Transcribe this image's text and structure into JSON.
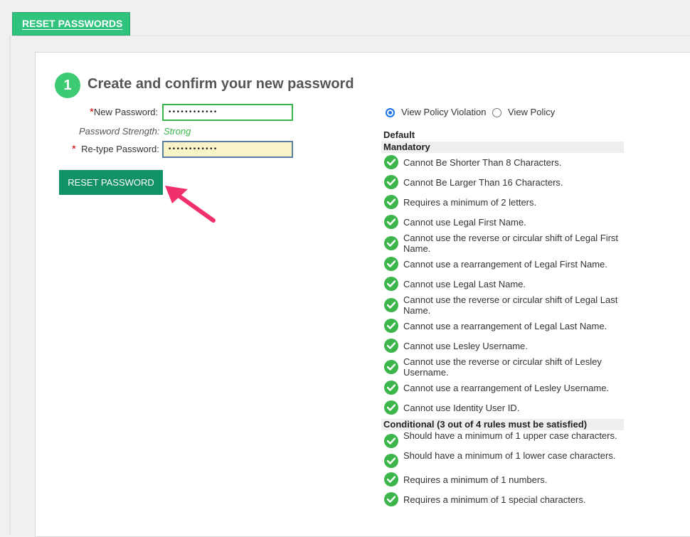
{
  "tab": {
    "label": "RESET PASSWORDS"
  },
  "step": {
    "number": "1",
    "title": "Create and confirm your new password"
  },
  "form": {
    "required_mark": "*",
    "new_password_label": "New Password:",
    "new_password_value": "••••••••••••",
    "strength_label": "Password Strength:",
    "strength_value": "Strong",
    "retype_label": "Re-type Password:",
    "retype_value": "••••••••••••",
    "reset_button": "RESET PASSWORD"
  },
  "view_options": {
    "option1": "View Policy Violation",
    "option2": "View Policy",
    "selected": "View Policy Violation"
  },
  "policy": {
    "name": "Default",
    "mandatory_heading": "Mandatory",
    "mandatory_rules": [
      "Cannot Be Shorter Than 8 Characters.",
      "Cannot Be Larger Than 16 Characters.",
      "Requires a minimum of 2 letters.",
      "Cannot use Legal First Name.",
      "Cannot use the reverse or circular shift of Legal First Name.",
      "Cannot use a rearrangement of Legal First Name.",
      "Cannot use Legal Last Name.",
      "Cannot use the reverse or circular shift of Legal Last Name.",
      "Cannot use a rearrangement of Legal Last Name.",
      "Cannot use Lesley Username.",
      "Cannot use the reverse or circular shift of Lesley Username.",
      "Cannot use a rearrangement of Lesley Username.",
      "Cannot use Identity User ID."
    ],
    "conditional_heading": "Conditional (3 out of 4 rules must be satisfied)",
    "conditional_rules": [
      "Should have a minimum of 1 upper case characters.",
      "Should have a minimum of 1 lower case characters.",
      "Requires a minimum of 1 numbers.",
      "Requires a minimum of 1 special characters."
    ]
  },
  "colors": {
    "accent_green": "#30c37e",
    "button_green": "#129165",
    "check_green": "#3cb54a",
    "arrow_pink": "#f0306a"
  }
}
